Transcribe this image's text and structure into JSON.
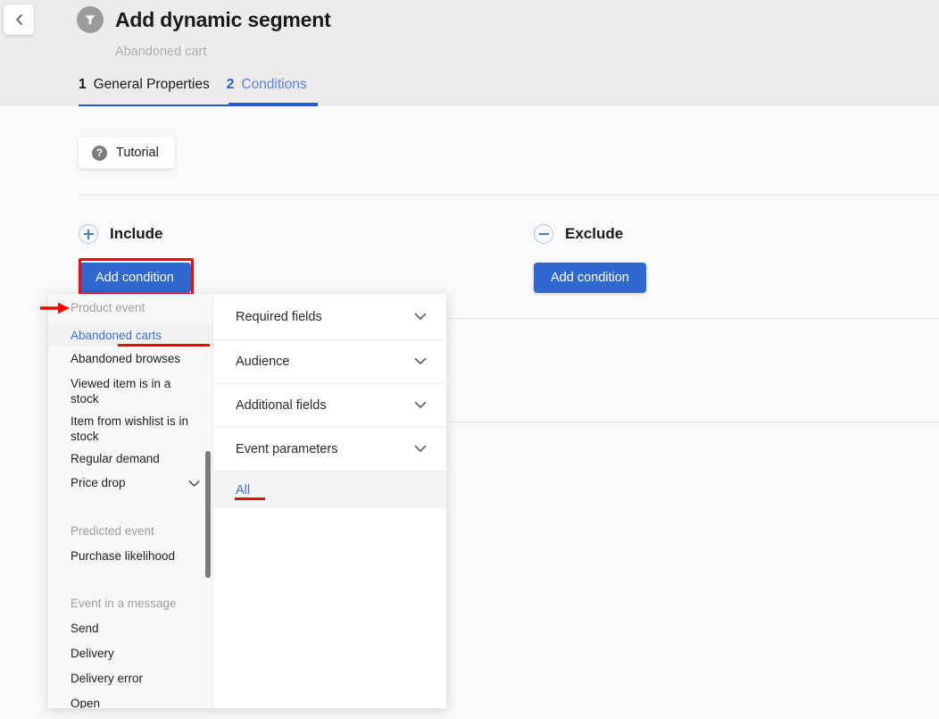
{
  "header": {
    "back_icon": "chevron-left-icon",
    "brand_icon": "funnel-icon",
    "title": "Add dynamic segment",
    "subtitle": "Abandoned cart",
    "tabs": [
      {
        "number": "1",
        "label": "General Properties",
        "state": "done"
      },
      {
        "number": "2",
        "label": "Conditions",
        "state": "active"
      }
    ]
  },
  "toolbar": {
    "tutorial_label": "Tutorial",
    "tutorial_icon": "question-mark-icon"
  },
  "sections": {
    "include": {
      "icon": "plus-circle-icon",
      "title": "Include",
      "add_condition_label": "Add condition",
      "highlighted": "true"
    },
    "exclude": {
      "icon": "minus-circle-icon",
      "title": "Exclude",
      "add_condition_label": "Add condition"
    }
  },
  "dropdown": {
    "left_panel": {
      "groups": [
        {
          "label": "Product event",
          "items": [
            {
              "label": "Abandoned carts",
              "selected": true,
              "annotated": true
            },
            {
              "label": "Abandoned browses"
            },
            {
              "label": "Viewed item is in a stock"
            },
            {
              "label": "Item from wishlist is in stock"
            },
            {
              "label": "Regular demand"
            },
            {
              "label": "Price drop",
              "chevron": "chevron-down-icon"
            }
          ]
        },
        {
          "label": "Predicted event",
          "items": [
            {
              "label": "Purchase likelihood"
            }
          ]
        },
        {
          "label": "Event in a message",
          "items": [
            {
              "label": "Send"
            },
            {
              "label": "Delivery"
            },
            {
              "label": "Delivery error"
            },
            {
              "label": "Open"
            }
          ]
        }
      ]
    },
    "right_panel": {
      "rows": [
        {
          "label": "Required fields",
          "chevron": "chevron-down-icon"
        },
        {
          "label": "Audience",
          "chevron": "chevron-down-icon"
        },
        {
          "label": "Additional fields",
          "chevron": "chevron-down-icon"
        },
        {
          "label": "Event parameters",
          "chevron": "chevron-down-icon"
        },
        {
          "label": "All",
          "selected": true,
          "annotated": true
        }
      ]
    }
  },
  "colors": {
    "accent_blue": "#2f68ce",
    "link_blue": "#3f6fd8",
    "annotation_red": "#ff0000",
    "header_bg": "#ececec",
    "page_bg": "#f9f9f9",
    "muted_text": "#9e9e9e"
  }
}
